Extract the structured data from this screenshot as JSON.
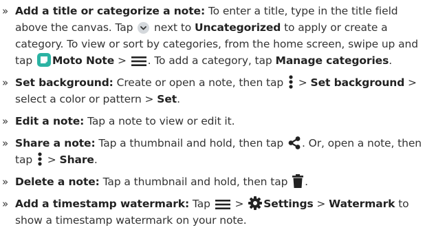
{
  "bullet": "»",
  "items": [
    {
      "title": "Add a title or categorize a note:",
      "t1": " To enter a title, type in the title field above the canvas. Tap ",
      "t2": " next to ",
      "b1": "Uncategorized",
      "t3": " to apply or create a category. To view or sort by categories, from the home screen, swipe up and tap ",
      "b2": "Moto Note",
      "t4": " > ",
      "t5": ". To add a category, tap ",
      "b3": "Manage categories",
      "t6": "."
    },
    {
      "title": "Set background:",
      "t1": " Create or open a note, then tap ",
      "t2": " > ",
      "b1": "Set background",
      "t3": " > select a color or pattern > ",
      "b2": "Set",
      "t4": "."
    },
    {
      "title": "Edit a note:",
      "t1": " Tap a note to view or edit it."
    },
    {
      "title": "Share a note:",
      "t1": " Tap a thumbnail and hold, then tap ",
      "t2": ". Or, open a note, then tap ",
      "t3": " > ",
      "b1": "Share",
      "t4": "."
    },
    {
      "title": "Delete a note:",
      "t1": " Tap a thumbnail and hold, then tap ",
      "t2": "."
    },
    {
      "title": "Add a timestamp watermark:",
      "t1": " Tap ",
      "t2": " > ",
      "b1": "Settings",
      "t3": " > ",
      "b2": "Watermark",
      "t4": " to show a timestamp watermark on your note."
    }
  ],
  "colors": {
    "text": "#333333",
    "icon": "#222222",
    "chevron_circle": "#d4d8dc",
    "moto_note_icon": "#2bb3a3"
  },
  "icons": {
    "chevron": "chevron-down-icon",
    "app": "moto-note-app-icon",
    "menu": "menu-icon",
    "more": "more-vert-icon",
    "share": "share-icon",
    "trash": "trash-icon",
    "gear": "gear-icon"
  }
}
